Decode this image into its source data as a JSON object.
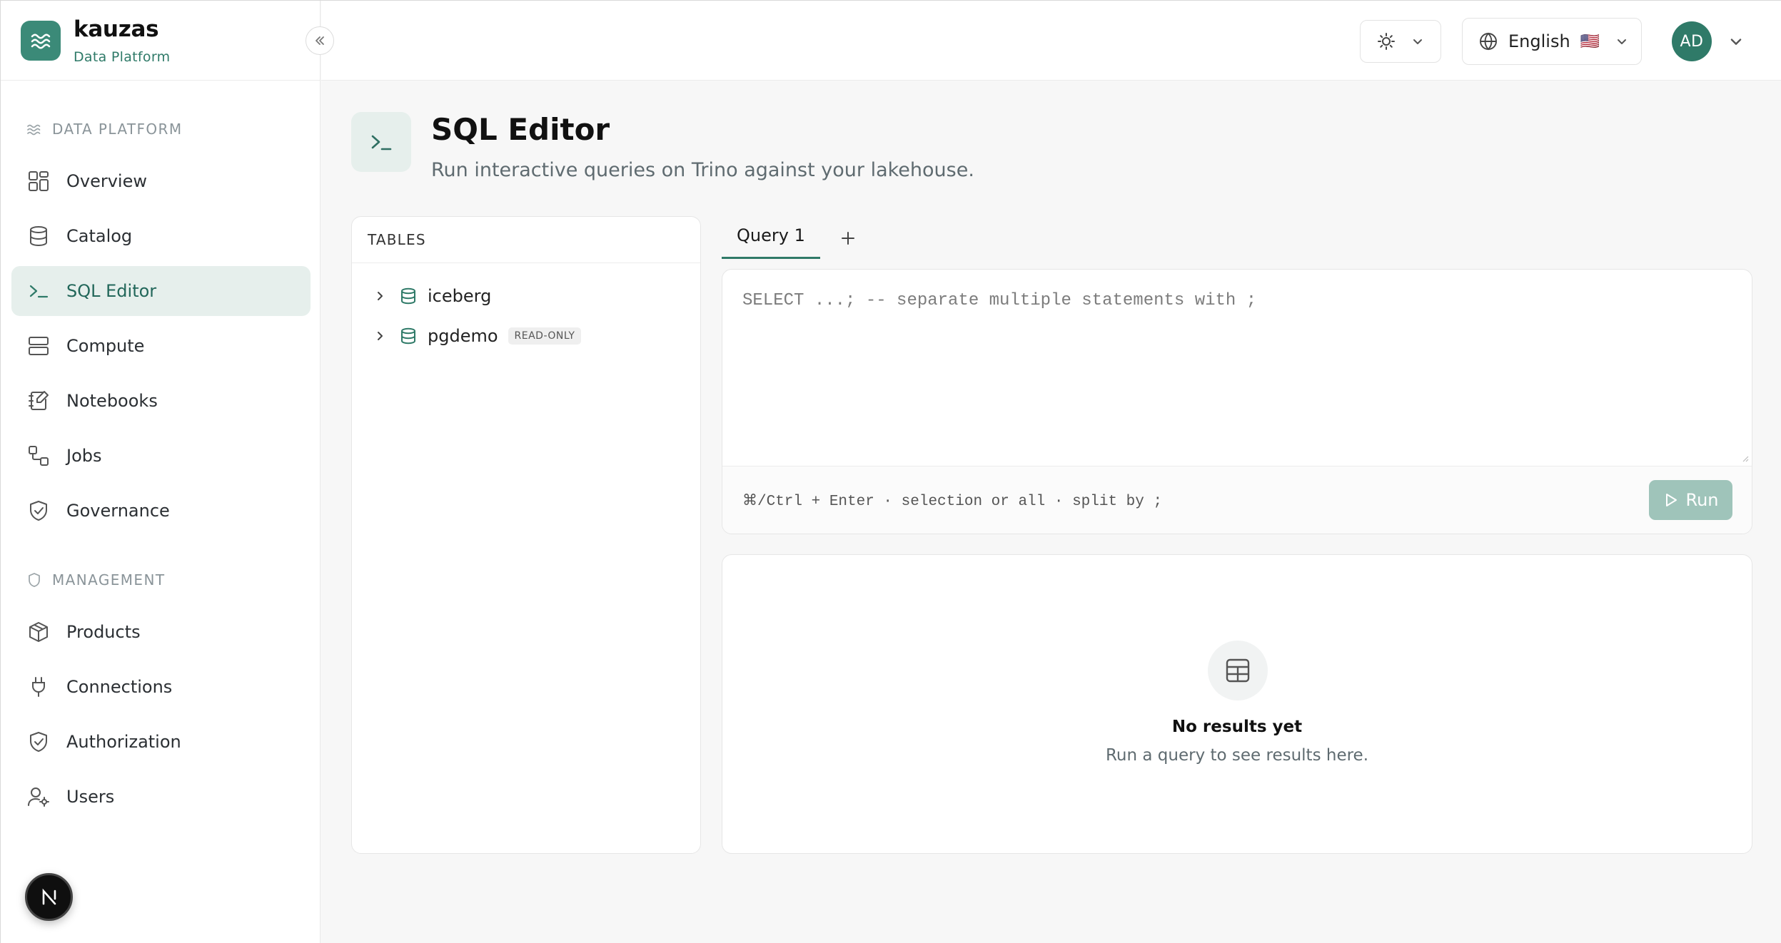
{
  "brand": {
    "name": "kauzas",
    "subtitle": "Data Platform"
  },
  "sidebar": {
    "sections": [
      {
        "title": "DATA PLATFORM",
        "items": [
          {
            "label": "Overview",
            "icon": "grid-icon"
          },
          {
            "label": "Catalog",
            "icon": "database-icon"
          },
          {
            "label": "SQL Editor",
            "icon": "terminal-icon",
            "active": true
          },
          {
            "label": "Compute",
            "icon": "server-icon"
          },
          {
            "label": "Notebooks",
            "icon": "notebook-icon"
          },
          {
            "label": "Jobs",
            "icon": "workflow-icon"
          },
          {
            "label": "Governance",
            "icon": "shield-check-icon"
          }
        ]
      },
      {
        "title": "MANAGEMENT",
        "items": [
          {
            "label": "Products",
            "icon": "package-icon"
          },
          {
            "label": "Connections",
            "icon": "plug-icon"
          },
          {
            "label": "Authorization",
            "icon": "shield-check-icon"
          },
          {
            "label": "Users",
            "icon": "user-gear-icon"
          }
        ]
      }
    ]
  },
  "topbar": {
    "language": "English",
    "flag": "🇺🇸",
    "avatar_initials": "AD"
  },
  "page": {
    "title": "SQL Editor",
    "subtitle": "Run interactive queries on Trino against your lakehouse."
  },
  "tables_panel": {
    "header": "TABLES",
    "items": [
      {
        "name": "iceberg",
        "badge": ""
      },
      {
        "name": "pgdemo",
        "badge": "READ-ONLY"
      }
    ]
  },
  "editor": {
    "tabs": [
      {
        "label": "Query 1"
      }
    ],
    "placeholder": "SELECT ...;  -- separate multiple statements with ;",
    "hint": "⌘/Ctrl + Enter · selection or all · split by ;",
    "run_label": "Run"
  },
  "results": {
    "empty_title": "No results yet",
    "empty_subtitle": "Run a query to see results here."
  },
  "colors": {
    "accent": "#2f7a68",
    "accent_soft": "#e6efec",
    "run_button_disabled": "#9fc4ba"
  }
}
